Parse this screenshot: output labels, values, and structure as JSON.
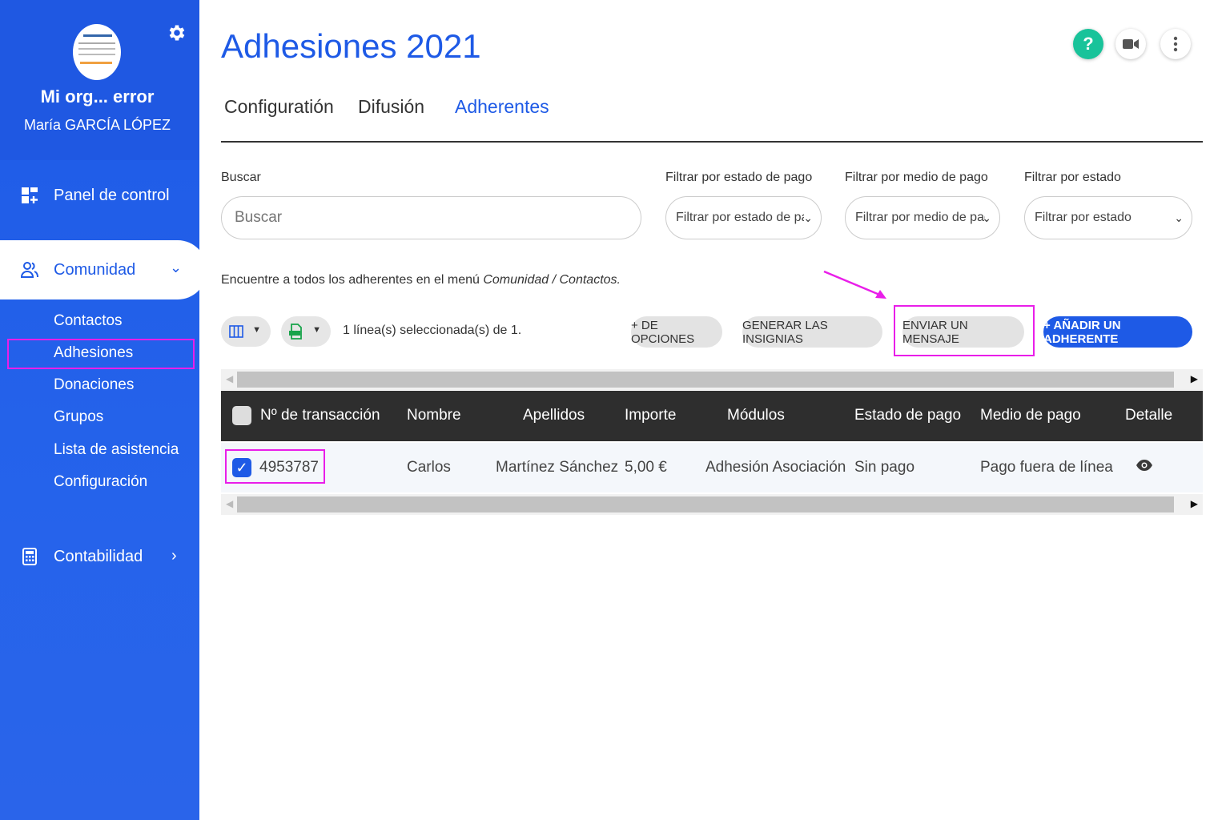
{
  "sidebar": {
    "org_name": "Mi org... error",
    "user_name": "María GARCÍA LÓPEZ",
    "nav": {
      "dashboard": "Panel de control",
      "community": "Comunidad",
      "accounting": "Contabilidad"
    },
    "community_items": [
      "Contactos",
      "Adhesiones",
      "Donaciones",
      "Grupos",
      "Lista de asistencia",
      "Configuración"
    ],
    "active_item": "Adhesiones"
  },
  "header": {
    "title": "Adhesiones 2021",
    "help_label": "?"
  },
  "tabs": [
    "Configuratión",
    "Difusión",
    "Adherentes"
  ],
  "active_tab": "Adherentes",
  "filters": {
    "search_label": "Buscar",
    "search_placeholder": "Buscar",
    "payment_status_label": "Filtrar por estado de pago",
    "payment_status_value": "Filtrar por estado de pago",
    "payment_method_label": "Filtrar por medio de pago",
    "payment_method_value": "Filtrar por medio de pago",
    "status_label": "Filtrar por estado",
    "status_value": "Filtrar por estado"
  },
  "info": {
    "text": "Encuentre a todos los adherentes en el menú ",
    "link": "Comunidad / Contactos."
  },
  "toolbar": {
    "selection": "1 línea(s) seleccionada(s) de 1.",
    "more_options": "+ DE OPCIONES",
    "badges": "GENERAR LAS INSIGNIAS",
    "send_message": "ENVIAR UN MENSAJE",
    "add_member": "+ AÑADIR UN ADHERENTE"
  },
  "table": {
    "columns": [
      "Nº de transacción",
      "Nombre",
      "Apellidos",
      "Importe",
      "Módulos",
      "Estado de pago",
      "Medio de pago",
      "Detalle"
    ],
    "rows": [
      {
        "transaction": "4953787",
        "first_name": "Carlos",
        "last_name": "Martínez Sánchez",
        "amount": "5,00 €",
        "module": "Adhesión Asociación",
        "payment_status": "Sin pago",
        "payment_method": "Pago fuera de línea",
        "selected": true
      }
    ]
  },
  "colors": {
    "primary": "#1e5ae6",
    "highlight": "#e91ee9",
    "help": "#19c39a"
  }
}
